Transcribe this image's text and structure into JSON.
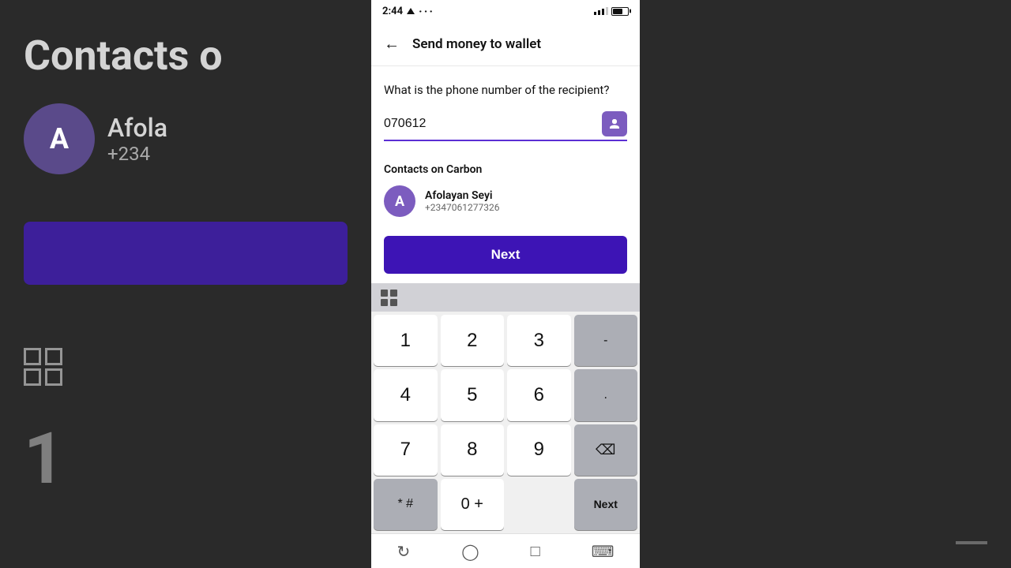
{
  "status_bar": {
    "time": "2:44",
    "signal_label": "signal",
    "battery_label": "battery"
  },
  "header": {
    "title": "Send money to wallet",
    "back_label": "back"
  },
  "form": {
    "question": "What is the phone number of the recipient?",
    "phone_value": "070612",
    "phone_placeholder": ""
  },
  "contacts": {
    "section_title": "Contacts on Carbon",
    "items": [
      {
        "initial": "A",
        "name": "Afolayan Seyi",
        "phone": "+2347061277326"
      }
    ]
  },
  "next_button_label": "Next",
  "keyboard": {
    "rows": [
      [
        "1",
        "2",
        "3",
        "-"
      ],
      [
        "4",
        "5",
        "6",
        "."
      ],
      [
        "7",
        "8",
        "9",
        "⌫"
      ],
      [
        "* #",
        "0 +",
        "",
        "Next"
      ]
    ]
  },
  "bg_left": {
    "title": "Contacts o",
    "name": "Afola",
    "phone": "+234",
    "initial": "A",
    "number": "1"
  }
}
